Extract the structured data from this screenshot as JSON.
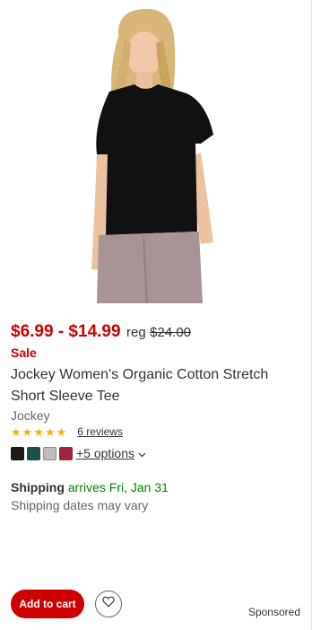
{
  "product": {
    "image_alt": "Jockey Women's Organic Cotton Stretch Short Sleeve Tee",
    "price": "$6.99 - $14.99",
    "reg_label": "reg",
    "original_price": "$24.00",
    "sale_label": "Sale",
    "title": "Jockey Women's Organic Cotton Stretch Short Sleeve Tee",
    "brand": "Jockey",
    "rating": 5,
    "reviews_label": "6 reviews",
    "swatches": [
      {
        "name": "black",
        "color": "#1a1a1a"
      },
      {
        "name": "dark-green",
        "color": "#1f4f4c"
      },
      {
        "name": "light-gray",
        "color": "#bdbdbd"
      },
      {
        "name": "cranberry",
        "color": "#a3233f"
      }
    ],
    "options_label": "+5 options"
  },
  "shipping": {
    "label": "Shipping",
    "date": "arrives Fri, Jan 31",
    "note": "Shipping dates may vary"
  },
  "actions": {
    "add_to_cart": "Add to cart",
    "favorite_icon": "heart-icon"
  },
  "sponsored_label": "Sponsored",
  "colors": {
    "price": "#cc0000",
    "shipping_date": "#008300",
    "star": "#ffb000",
    "button": "#cc0000"
  }
}
